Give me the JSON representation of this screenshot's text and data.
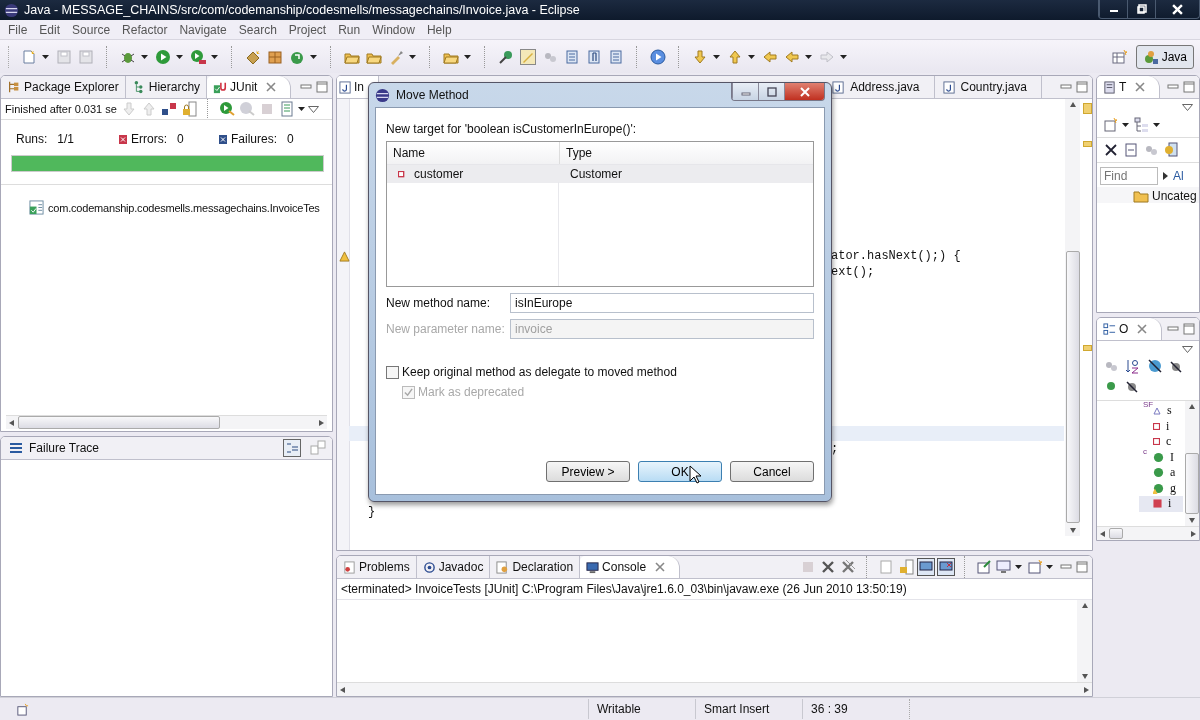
{
  "window": {
    "title": "Java - MESSAGE_CHAINS/src/com/codemanship/codesmells/messagechains/Invoice.java - Eclipse"
  },
  "menu": [
    "File",
    "Edit",
    "Source",
    "Refactor",
    "Navigate",
    "Search",
    "Project",
    "Run",
    "Window",
    "Help"
  ],
  "perspective": {
    "label": "Java",
    "selected": true
  },
  "junit_view": {
    "tabs": [
      {
        "label": "Package Explorer",
        "selected": false
      },
      {
        "label": "Hierarchy",
        "selected": false
      },
      {
        "label": "JUnit",
        "selected": true
      }
    ],
    "status": "Finished after 0.031 se",
    "counters": [
      {
        "kind": "runs",
        "label": "Runs:",
        "value": "1/1"
      },
      {
        "kind": "errors",
        "label": "Errors:",
        "value": "0"
      },
      {
        "kind": "failures",
        "label": "Failures:",
        "value": "0"
      }
    ],
    "progress": {
      "level": 1,
      "passed": true
    },
    "tree": [
      {
        "label": "com.codemanship.codesmells.messagechains.InvoiceTes",
        "passed": true
      }
    ]
  },
  "failure_trace": {
    "title": "Failure Trace"
  },
  "editor": {
    "tabs": [
      {
        "label": "In",
        "selected": true
      },
      {
        "label": "Address.java",
        "selected": false
      },
      {
        "label": "Country.java",
        "selected": false
      }
    ],
    "code_lines": [
      {
        "text": "ator.hasNext();) {"
      },
      {
        "text": "ext();"
      },
      {
        "text": ";"
      },
      {
        "text": "}"
      }
    ]
  },
  "tasks_view": {
    "tab": {
      "label": "T",
      "selected": true
    },
    "find": {
      "placeholder": "Find"
    },
    "all_link": "Al",
    "category": "Uncateg"
  },
  "outline_view": {
    "tab": {
      "label": "O",
      "selected": true
    },
    "items": [
      {
        "kind": "static-final",
        "badge": "SF",
        "text": "s",
        "selected": false
      },
      {
        "kind": "field",
        "text": "i",
        "selected": false
      },
      {
        "kind": "field",
        "text": "c",
        "selected": false
      },
      {
        "kind": "constructor",
        "badge": "c",
        "text": "I",
        "selected": false
      },
      {
        "kind": "method",
        "text": "a",
        "selected": false
      },
      {
        "kind": "method-warning",
        "text": "g",
        "selected": false
      },
      {
        "kind": "private-method",
        "text": "i",
        "selected": true
      }
    ]
  },
  "console_view": {
    "tabs": [
      {
        "label": "Problems",
        "selected": false
      },
      {
        "label": "Javadoc",
        "selected": false
      },
      {
        "label": "Declaration",
        "selected": false
      },
      {
        "label": "Console",
        "selected": true
      }
    ],
    "header": "<terminated> InvoiceTests [JUnit] C:\\Program Files\\Java\\jre1.6.0_03\\bin\\javaw.exe (26 Jun 2010 13:50:19)"
  },
  "status_bar": [
    "Writable",
    "Smart Insert",
    "36 : 39"
  ],
  "dialog": {
    "title": "Move Method",
    "prompt": "New target for 'boolean isCustomerInEurope()':",
    "columns": [
      "Name",
      "Type"
    ],
    "rows": [
      {
        "name": "customer",
        "type": "Customer",
        "selected": true
      }
    ],
    "method_name": {
      "label": "New method name:",
      "value": "isInEurope",
      "disabled": false
    },
    "parameter_name": {
      "label": "New parameter name:",
      "value": "invoice",
      "disabled": true
    },
    "keep_delegate": {
      "label": "Keep original method as delegate to moved method",
      "checked": false,
      "disabled": false
    },
    "mark_deprecated": {
      "label": "Mark as deprecated",
      "checked": true,
      "disabled": true
    },
    "buttons": [
      {
        "label": "Preview >",
        "default": false
      },
      {
        "label": "OK",
        "default": true
      },
      {
        "label": "Cancel",
        "default": false
      }
    ]
  }
}
